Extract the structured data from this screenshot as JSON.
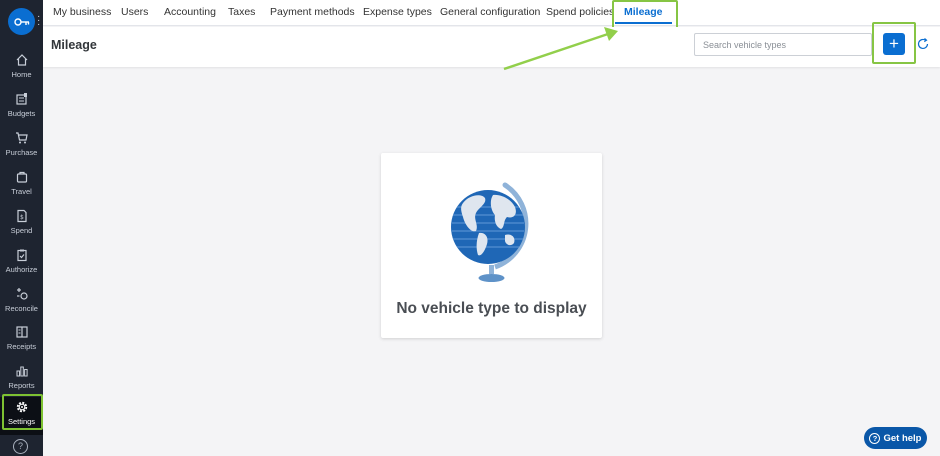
{
  "sidebar": {
    "items": [
      {
        "label": "Home",
        "icon": "home-icon"
      },
      {
        "label": "Budgets",
        "icon": "budgets-icon"
      },
      {
        "label": "Purchase",
        "icon": "cart-icon"
      },
      {
        "label": "Travel",
        "icon": "suitcase-icon"
      },
      {
        "label": "Spend",
        "icon": "receipt-icon"
      },
      {
        "label": "Authorize",
        "icon": "clipboard-icon"
      },
      {
        "label": "Reconcile",
        "icon": "reconcile-icon"
      },
      {
        "label": "Receipts",
        "icon": "receipts-icon"
      },
      {
        "label": "Reports",
        "icon": "bar-chart-icon"
      },
      {
        "label": "Settings",
        "icon": "gear-icon"
      }
    ],
    "active": "Settings",
    "help_glyph": "?"
  },
  "tabs": [
    {
      "label": "My business"
    },
    {
      "label": "Users"
    },
    {
      "label": "Accounting"
    },
    {
      "label": "Taxes"
    },
    {
      "label": "Payment methods"
    },
    {
      "label": "Expense types"
    },
    {
      "label": "General configuration"
    },
    {
      "label": "Spend policies"
    },
    {
      "label": "Mileage"
    }
  ],
  "active_tab": "Mileage",
  "header": {
    "title": "Mileage",
    "search_placeholder": "Search vehicle types",
    "add_label": "+"
  },
  "empty_state": {
    "message": "No vehicle type to display",
    "illustration": "globe-icon"
  },
  "help_button": {
    "label": "Get help",
    "glyph": "?"
  },
  "colors": {
    "accent": "#0a6ed1",
    "highlight": "#86c544",
    "sidebar_bg": "#1e2430"
  }
}
